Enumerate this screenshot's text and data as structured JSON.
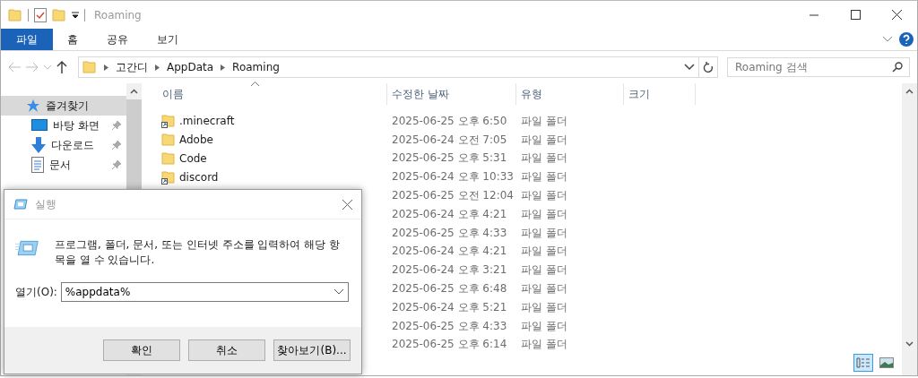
{
  "window": {
    "title": "Roaming"
  },
  "ribbon_tabs": [
    {
      "label": "파일",
      "selected": true
    },
    {
      "label": "홈",
      "selected": false
    },
    {
      "label": "공유",
      "selected": false
    },
    {
      "label": "보기",
      "selected": false
    }
  ],
  "address": {
    "crumbs": [
      "고간디",
      "AppData",
      "Roaming"
    ]
  },
  "search": {
    "placeholder": "Roaming 검색"
  },
  "sidebar": {
    "items": [
      {
        "label": "즐겨찾기",
        "kind": "star",
        "selected": true,
        "pinned": false
      },
      {
        "label": "바탕 화면",
        "kind": "desktop",
        "selected": false,
        "pinned": true
      },
      {
        "label": "다운로드",
        "kind": "download",
        "selected": false,
        "pinned": true
      },
      {
        "label": "문서",
        "kind": "document",
        "selected": false,
        "pinned": true
      }
    ]
  },
  "table": {
    "columns": [
      "이름",
      "수정한 날짜",
      "유형",
      "크기"
    ],
    "rows": [
      {
        "name": ".minecraft",
        "kind": "shortcut",
        "date": "2025-06-25 오후 6:50",
        "type": "파일 폴더"
      },
      {
        "name": "Adobe",
        "kind": "folder",
        "date": "2025-06-24 오전 7:05",
        "type": "파일 폴더"
      },
      {
        "name": "Code",
        "kind": "folder",
        "date": "2025-06-25 오후 5:31",
        "type": "파일 폴더"
      },
      {
        "name": "discord",
        "kind": "shortcut",
        "date": "2025-06-24 오후 10:33",
        "type": "파일 폴더"
      },
      {
        "date": "2025-06-25 오전 12:04",
        "type": "파일 폴더"
      },
      {
        "date": "2025-06-24 오후 4:21",
        "type": "파일 폴더"
      },
      {
        "date": "2025-06-25 오후 4:33",
        "type": "파일 폴더"
      },
      {
        "date": "2025-06-24 오후 4:21",
        "type": "파일 폴더"
      },
      {
        "date": "2025-06-24 오후 3:21",
        "type": "파일 폴더"
      },
      {
        "date": "2025-06-25 오후 6:48",
        "type": "파일 폴더"
      },
      {
        "date": "2025-06-24 오후 5:21",
        "type": "파일 폴더"
      },
      {
        "date": "2025-06-25 오후 4:33",
        "type": "파일 폴더"
      },
      {
        "date": "2025-06-25 오후 6:14",
        "type": "파일 폴더"
      }
    ]
  },
  "view_buttons": [
    {
      "kind": "details",
      "selected": true
    },
    {
      "kind": "thumbnails",
      "selected": false
    }
  ],
  "run_dialog": {
    "title": "실행",
    "message": "프로그램, 폴더, 문서, 또는 인터넷 주소를 입력하여 해당 항목을 열 수 있습니다.",
    "open_label": "열기(O):",
    "value": "%appdata%",
    "buttons": [
      "확인",
      "취소",
      "찾아보기(B)..."
    ]
  }
}
